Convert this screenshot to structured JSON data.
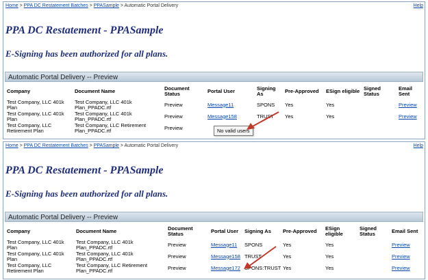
{
  "breadcrumb": {
    "home": "Home",
    "sep": " > ",
    "batches": "PPA DC Restatement Batches",
    "sample": "PPASample",
    "current": "Automatic Portal Delivery"
  },
  "help": "Help",
  "page_title": "PPA DC Restatement - PPASample",
  "subtitle": "E-Signing has been authorized for all plans.",
  "section_header": "Automatic Portal Delivery -- Preview",
  "columns": {
    "company": "Company",
    "document_name": "Document Name",
    "document_status": "Document Status",
    "portal_user": "Portal User",
    "signing_as": "Signing As",
    "pre_approved": "Pre-Approved",
    "esign_eligible": "ESign eligible",
    "signed_status": "Signed Status",
    "email_sent": "Email Sent"
  },
  "top": {
    "rows": [
      {
        "company": "Test Company, LLC 401k Plan",
        "document": "Test Company, LLC 401k Plan_PPADC.rtf",
        "status": "Preview",
        "portal_user": "Message11",
        "signing_as": "SPONS",
        "pre_approved": "Yes",
        "esign": "Yes",
        "signed": "",
        "email": "Preview"
      },
      {
        "company": "Test Company, LLC 401k Plan",
        "document": "Test Company, LLC 401k Plan_PPADC.rtf",
        "status": "Preview",
        "portal_user": "Message158",
        "signing_as": "TRUST",
        "pre_approved": "Yes",
        "esign": "Yes",
        "signed": "",
        "email": "Preview"
      },
      {
        "company": "Test Company, LLC Retirement Plan",
        "document": "Test Company, LLC Retirement Plan_PPADC.rtf",
        "status": "Preview",
        "portal_user": "",
        "signing_as": "",
        "pre_approved": "",
        "esign": "",
        "signed": "",
        "email": ""
      }
    ],
    "tooltip": "No valid users"
  },
  "bottom": {
    "rows": [
      {
        "company": "Test Company, LLC 401k Plan",
        "document": "Test Company, LLC 401k Plan_PPADC.rtf",
        "status": "Preview",
        "portal_user": "Message11",
        "signing_as": "SPONS",
        "pre_approved": "Yes",
        "esign": "Yes",
        "signed": "",
        "email": "Preview"
      },
      {
        "company": "Test Company, LLC 401k Plan",
        "document": "Test Company, LLC 401k Plan_PPADC.rtf",
        "status": "Preview",
        "portal_user": "Message158",
        "signing_as": "TRUST",
        "pre_approved": "Yes",
        "esign": "Yes",
        "signed": "",
        "email": "Preview"
      },
      {
        "company": "Test Company, LLC Retirement Plan",
        "document": "Test Company, LLC Retirement Plan_PPADC.rtf",
        "status": "Preview",
        "portal_user": "Message172",
        "signing_as": "SPONS:TRUST",
        "pre_approved": "Yes",
        "esign": "Yes",
        "signed": "",
        "email": "Preview"
      }
    ]
  },
  "colors": {
    "title": "#1f2e7a",
    "link": "#0645ad",
    "arrow": "#c0392b",
    "header_bar": "#b9c9d8"
  }
}
